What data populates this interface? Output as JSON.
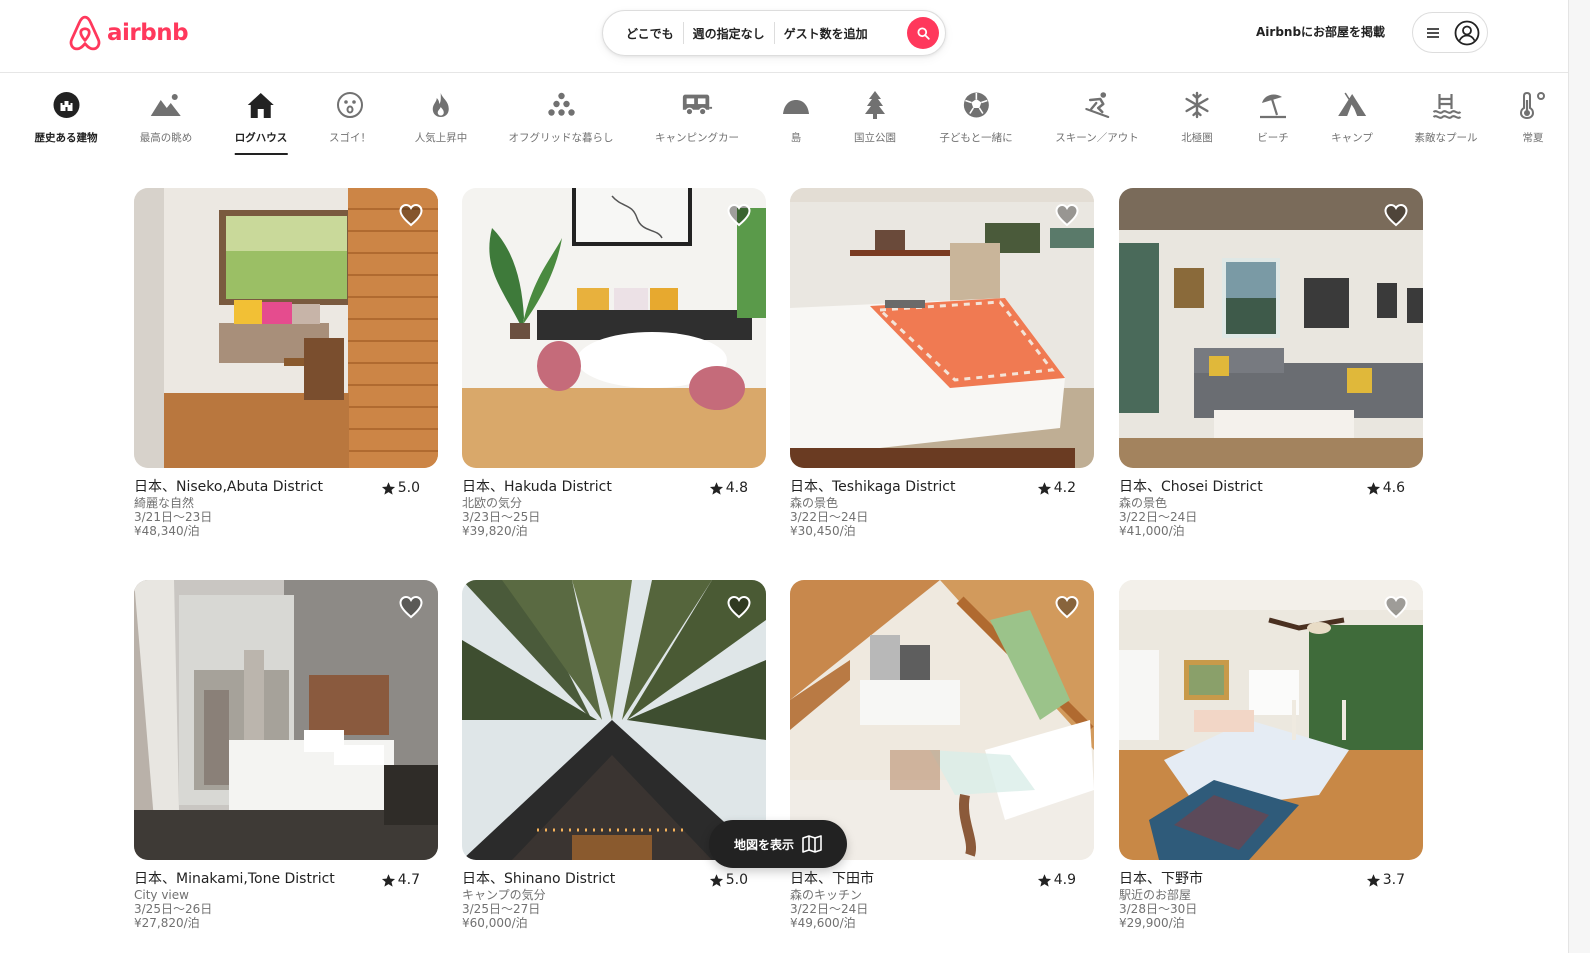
{
  "brand": {
    "name": "airbnb",
    "color": "#ff385c",
    "icon": "airbnb-logo-icon"
  },
  "search": {
    "location": "どこでも",
    "dates": "週の指定なし",
    "guests": "ゲスト数を追加",
    "button_icon": "search-icon"
  },
  "header": {
    "host_link": "Airbnbにお部屋を掲載",
    "menu_icon": "hamburger-icon",
    "avatar_icon": "user-avatar-icon"
  },
  "categories": [
    {
      "label": "歴史ある建物",
      "icon": "castle-icon"
    },
    {
      "label": "最高の眺め",
      "icon": "mountain-view-icon"
    },
    {
      "label": "ログハウス",
      "icon": "cabin-icon",
      "active": true
    },
    {
      "label": "スゴイ！",
      "icon": "wow-face-icon"
    },
    {
      "label": "人気上昇中",
      "icon": "fire-icon"
    },
    {
      "label": "オフグリッドな暮らし",
      "icon": "off-grid-icon"
    },
    {
      "label": "キャンピングカー",
      "icon": "campervan-icon"
    },
    {
      "label": "島",
      "icon": "island-icon"
    },
    {
      "label": "国立公園",
      "icon": "pine-tree-icon"
    },
    {
      "label": "子どもと一緒に",
      "icon": "soccer-ball-icon"
    },
    {
      "label": "スキーン／アウト",
      "icon": "skier-icon"
    },
    {
      "label": "北極圏",
      "icon": "snowflake-icon"
    },
    {
      "label": "ビーチ",
      "icon": "beach-umbrella-icon"
    },
    {
      "label": "キャンプ",
      "icon": "tent-icon"
    },
    {
      "label": "素敵なプール",
      "icon": "pool-icon"
    },
    {
      "label": "常夏",
      "icon": "thermometer-icon"
    }
  ],
  "listings": [
    {
      "location": "日本、Niseko,Abuta District",
      "rating": "5.0",
      "subtitle": "綺麗な自然",
      "dates": "3/21日～23日",
      "price": "¥48,340/泊"
    },
    {
      "location": "日本、Hakuda District",
      "rating": "4.8",
      "subtitle": "北欧の気分",
      "dates": "3/23日～25日",
      "price": "¥39,820/泊"
    },
    {
      "location": "日本、Teshikaga District",
      "rating": "4.2",
      "subtitle": "森の景色",
      "dates": "3/22日～24日",
      "price": "¥30,450/泊"
    },
    {
      "location": "日本、Chosei District",
      "rating": "4.6",
      "subtitle": "森の景色",
      "dates": "3/22日～24日",
      "price": "¥41,000/泊"
    },
    {
      "location": "日本、Minakami,Tone District",
      "rating": "4.7",
      "subtitle": "City view",
      "dates": "3/25日～26日",
      "price": "¥27,820/泊"
    },
    {
      "location": "日本、Shinano District",
      "rating": "5.0",
      "subtitle": "キャンプの気分",
      "dates": "3/25日～27日",
      "price": "¥60,000/泊"
    },
    {
      "location": "日本、下田市",
      "rating": "4.9",
      "subtitle": "森のキッチン",
      "dates": "3/22日～24日",
      "price": "¥49,600/泊"
    },
    {
      "location": "日本、下野市",
      "rating": "3.7",
      "subtitle": "駅近のお部屋",
      "dates": "3/28日～30日",
      "price": "¥29,900/泊"
    }
  ],
  "map_button": {
    "label": "地図を表示",
    "icon": "map-icon"
  }
}
